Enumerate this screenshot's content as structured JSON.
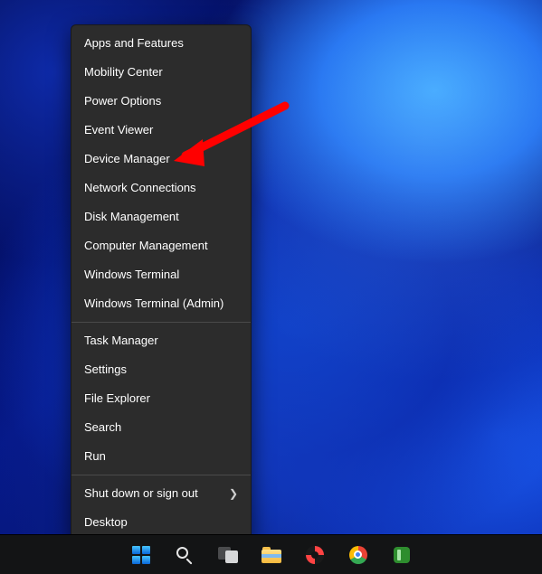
{
  "menu": {
    "groups": [
      [
        "Apps and Features",
        "Mobility Center",
        "Power Options",
        "Event Viewer",
        "Device Manager",
        "Network Connections",
        "Disk Management",
        "Computer Management",
        "Windows Terminal",
        "Windows Terminal (Admin)"
      ],
      [
        "Task Manager",
        "Settings",
        "File Explorer",
        "Search",
        "Run"
      ],
      [
        "Shut down or sign out",
        "Desktop"
      ]
    ],
    "has_submenu_label": "Shut down or sign out"
  },
  "annotation": {
    "target_label": "Device Manager",
    "arrow_color": "#ff0000"
  },
  "taskbar": {
    "items": [
      {
        "name": "start-button",
        "label": "Start"
      },
      {
        "name": "search-button",
        "label": "Search"
      },
      {
        "name": "task-view-button",
        "label": "Task View"
      },
      {
        "name": "file-explorer-button",
        "label": "File Explorer"
      },
      {
        "name": "app-red-swirl-button",
        "label": "App"
      },
      {
        "name": "chrome-button",
        "label": "Google Chrome"
      },
      {
        "name": "app-green-button",
        "label": "App"
      }
    ]
  }
}
